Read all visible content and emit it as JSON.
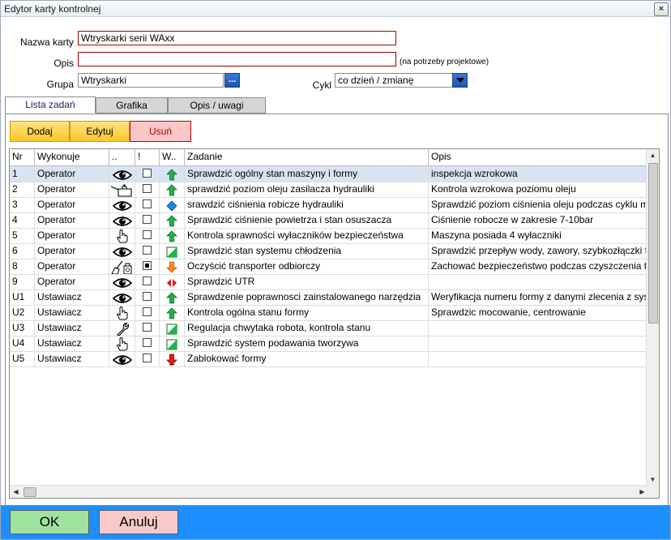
{
  "window": {
    "title": "Edytor karty kontrolnej",
    "close_label": "×"
  },
  "form": {
    "name_label": "Nazwa karty",
    "name_value": "Wtryskarki serii WAxx",
    "desc_label": "Opis",
    "desc_value": "",
    "desc_note": "(na potrzeby projektowe)",
    "group_label": "Grupa",
    "group_value": "Wtryskarki",
    "group_button": "...",
    "cycle_label": "Cykl",
    "cycle_value": "co dzień / zmianę"
  },
  "tabs": [
    {
      "label": "Lista zadań",
      "active": true
    },
    {
      "label": "Grafika",
      "active": false
    },
    {
      "label": "Opis / uwagi",
      "active": false
    }
  ],
  "toolbar": {
    "add": "Dodaj",
    "edit": "Edytuj",
    "delete": "Usuń"
  },
  "grid": {
    "headers": {
      "nr": "Nr",
      "who": "Wykonuje",
      "method": "..",
      "flag": "!",
      "priority": "W..",
      "task": "Zadanie",
      "desc": "Opis"
    },
    "rows": [
      {
        "nr": "1",
        "who": "Operator",
        "method": "eye-icon",
        "flag": false,
        "priority": "arrow-up-green-icon",
        "task": "Sprawdzić ogólny stan maszyny i formy",
        "desc": "inspekcja wzrokowa",
        "selected": true
      },
      {
        "nr": "2",
        "who": "Operator",
        "method": "oil-can-icon",
        "flag": false,
        "priority": "arrow-up-green-icon",
        "task": "sprawdzić poziom oleju  zasilacza hydrauliki",
        "desc": "Kontrola wzrokowa poziomu oleju",
        "selected": false
      },
      {
        "nr": "3",
        "who": "Operator",
        "method": "eye-icon",
        "flag": false,
        "priority": "diamond-blue-icon",
        "task": "srawdzić ciśnienia robicze hydrauliki",
        "desc": "Sprawdzić poziom ciśnienia oleju podczas cyklu maszyny",
        "selected": false
      },
      {
        "nr": "4",
        "who": "Operator",
        "method": "eye-icon",
        "flag": false,
        "priority": "arrow-up-green-icon",
        "task": "Sprawdzić ciśnienie powietrza i stan osuszacza",
        "desc": "Ciśnienie robocze w zakresie 7-10bar",
        "selected": false
      },
      {
        "nr": "5",
        "who": "Operator",
        "method": "hand-icon",
        "flag": false,
        "priority": "arrow-up-green-icon",
        "task": "Kontrola sprawności wyłaczników bezpieczeństwa",
        "desc": "Maszyna posiada 4 wyłaczniki",
        "selected": false
      },
      {
        "nr": "6",
        "who": "Operator",
        "method": "eye-icon",
        "flag": false,
        "priority": "half-square-green-icon",
        "task": "Sprawdzić stan systemu chłodzenia",
        "desc": "Sprawdzić przepływ wody, zawory, szybkozłączki form",
        "selected": false
      },
      {
        "nr": "8",
        "who": "Operator",
        "method": "cleaning-icon",
        "flag": true,
        "priority": "arrow-down-orange-icon",
        "task": "Oczyścić transporter odbiorczy",
        "desc": "Zachować bezpieczeństwo podczas czyszczenia transportera",
        "selected": false
      },
      {
        "nr": "9",
        "who": "Operator",
        "method": "eye-icon",
        "flag": false,
        "priority": "double-arrow-red-icon",
        "task": "Sprawdzić UTR",
        "desc": "",
        "selected": false
      },
      {
        "nr": "U1",
        "who": "Ustawiacz",
        "method": "eye-icon",
        "flag": false,
        "priority": "arrow-up-green-icon",
        "task": "Sprawdzenie poprawnosci zainstalowanego narzędzia",
        "desc": "Weryfikacja numeru formy z danymi zlecenia z systemu",
        "selected": false
      },
      {
        "nr": "U2",
        "who": "Ustawiacz",
        "method": "hand-icon",
        "flag": false,
        "priority": "arrow-up-green-icon",
        "task": "Kontrola ogólna stanu formy",
        "desc": "Sprawdzic mocowanie, centrowanie",
        "selected": false
      },
      {
        "nr": "U3",
        "who": "Ustawiacz",
        "method": "wrench-icon",
        "flag": false,
        "priority": "half-square-green-icon",
        "task": "Regulacja chwytaka robota, kontrola stanu",
        "desc": "",
        "selected": false
      },
      {
        "nr": "U4",
        "who": "Ustawiacz",
        "method": "hand-icon",
        "flag": false,
        "priority": "half-square-green-icon",
        "task": "Sprawdzić system podawania tworzywa",
        "desc": "",
        "selected": false
      },
      {
        "nr": "U5",
        "who": "Ustawiacz",
        "method": "eye-icon",
        "flag": false,
        "priority": "arrow-down-red-icon",
        "task": "Zablokować formy",
        "desc": "",
        "selected": false
      }
    ]
  },
  "footer": {
    "ok": "OK",
    "cancel": "Anuluj"
  },
  "colors": {
    "footer_bg": "#1e8fff",
    "ok_bg": "#9fe39f",
    "cancel_bg": "#f7c9c9",
    "toolbar_yellow": "#ffd34d",
    "delete_bg": "#f9c7c7",
    "selected_row": "#d8e4f4"
  }
}
